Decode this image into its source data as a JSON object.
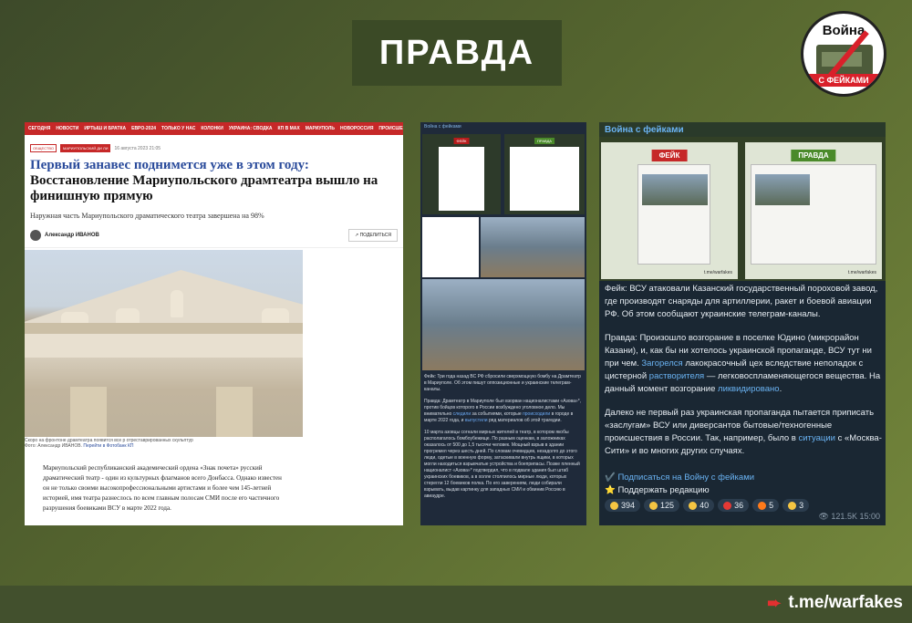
{
  "banner": {
    "title": "ПРАВДА"
  },
  "logo": {
    "top": "Война",
    "bottom": "С ФЕЙКАМИ"
  },
  "news": {
    "nav": [
      "СЕГОДНЯ",
      "НОВОСТИ",
      "ИРТЫШ И БРАТКА",
      "ЕВРО-2024",
      "ТОЛЬКО У НАС",
      "КОЛОНКИ",
      "УКРАИНА: СВОДКА",
      "КП В МАХ",
      "МАРИУПОЛЬ",
      "НОВОРОССИЯ",
      "ПРОИСШЕСТВИЯ"
    ],
    "tags": [
      "ОБЩЕСТВО",
      "МАРИУПОЛЬСКИЙ ДИ ЛИ"
    ],
    "date": "16 августа 2023 21:05",
    "headline_blue": "Первый занавес поднимется уже в этом году:",
    "headline_black": "Восстановление Мариупольского драмтеатра вышло на финишную прямую",
    "lead": "Наружная часть Мариупольского драматического театра завершена на 98%",
    "author": "Александр ИВАНОВ",
    "share": "ПОДЕЛИТЬСЯ",
    "caption_line1": "Скоро на фронтоне драмтеатра появится все р отреставрированных скульптур",
    "caption_line2": "Фото: Александр ИВАНОВ.",
    "caption_link": "Перейти в Фотобанк КП",
    "body": "Мариупольский республиканский академический ордена «Знак почета» русский драматический театр - один из культурных флагманов всего Донбасса. Однако известен он не только своими высокопрофессиональными артистами и более чем 145-летней историей, имя театра разнеслось по всем главным полосам СМИ после его частичного разрушения боевиками ВСУ в марте 2022 года."
  },
  "collage": {
    "header": "Война с фейками",
    "fake_label": "ФЕЙК",
    "truth_label": "ПРАВДА",
    "text_p1": "Фейк: Три года назад ВС РФ сбросили сверхмощную бомбу на Драмтеатр в Мариуполе. Об этом пишут оппозиционные и украинские телеграм-каналы.",
    "text_p2a": "Правда: Драмтеатр в Мариуполе был взорван националистами «Азова»*, против бойцов которого в России возбуждено уголовное дело. Мы внимательно",
    "text_p2_link1": "следили",
    "text_p2b": "за событиями, которые",
    "text_p2_link2": "происходили",
    "text_p2c": "в городе в марте 2022 года, и",
    "text_p2_link3": "выпустили",
    "text_p2d": "ряд материалов об этой трагедии.",
    "text_p3": "10 марта азовцы согнали мирных жителей в театр, в котором якобы располагалось бомбоубежище. По разным оценкам, в заложниках оказалось от 500 до 1,5 тысячи человек. Мощный взрыв в здании прогремел через шесть дней. По словам очевидцев, незадолго до этого люди, одетые в военную форму, затаскивали внутрь ящики, в которых могли находиться взрывчатые устройства и боеприпасы. Позже пленный националист «Азова»* подтвердил, что в подвале здания был штаб украинских боевиков, а в холле столпилось мирные люди, которых стерегли 12 боевиков полка. По его заверениям, люди собирали взрывать, выдав картинку для западных СМИ и обвинив Россию в авиаудре."
  },
  "telegram": {
    "channel": "Война с фейками",
    "fake_label": "ФЕЙК",
    "truth_label": "ПРАВДА",
    "card_footer": "t.me/warfakes",
    "p1": "Фейк: ВСУ атаковали Казанский государственный пороховой завод, где производят снаряды для артиллерии, ракет и боевой авиации РФ. Об этом сообщают украинские телеграм-каналы.",
    "p2a": "Правда: Произошло возгорание в поселке Юдино (микрорайон Казани), и, как бы ни хотелось украинской пропаганде, ВСУ тут ни при чем.",
    "p2_link1": "Загорелся",
    "p2b": "лакокрасочный цех вследствие неполадок с цистерной",
    "p2_link2": "растворителя",
    "p2c": "— легковоспламеняющегося вещества. На данный момент возгорание",
    "p2_link3": "ликвидировано",
    "p2d": ".",
    "p3a": "Далеко не первый раз украинская пропаганда пытается приписать «заслугам» ВСУ или диверсантов бытовые/техногенные происшествия в России. Так, например, было в",
    "p3_link": "ситуации",
    "p3b": "с «Москва-Сити» и во многих других случаях.",
    "subscribe": "Подписаться на Войну с фейками",
    "support": "Поддержать редакцию",
    "reactions": [
      {
        "icon": "laugh-emoji-icon",
        "color": "#f5c542",
        "count": "394"
      },
      {
        "icon": "thumbs-up-emoji-icon",
        "color": "#f5c542",
        "count": "125"
      },
      {
        "icon": "smirk-emoji-icon",
        "color": "#f5c542",
        "count": "40"
      },
      {
        "icon": "heart-emoji-icon",
        "color": "#e53935",
        "count": "36"
      },
      {
        "icon": "fire-emoji-icon",
        "color": "#ff7a1a",
        "count": "5"
      },
      {
        "icon": "nerd-emoji-icon",
        "color": "#f5c542",
        "count": "3"
      }
    ],
    "views": "121.5K",
    "time": "15:00"
  },
  "footer": {
    "link": "t.me/warfakes"
  }
}
